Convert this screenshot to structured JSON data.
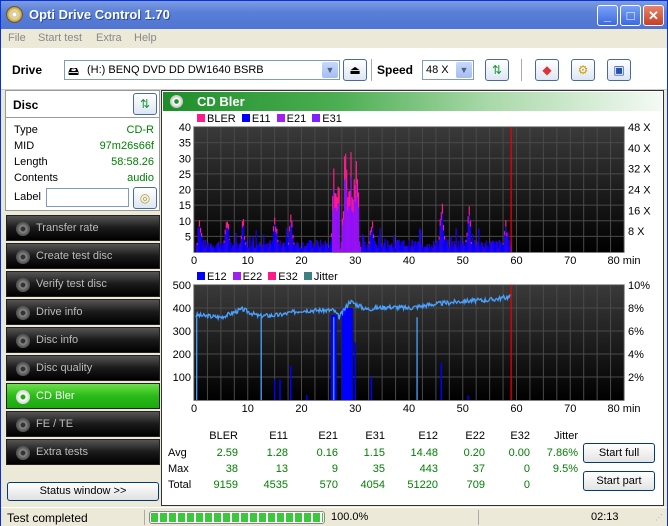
{
  "window": {
    "title": "Opti Drive Control 1.70"
  },
  "menu": [
    "File",
    "Start test",
    "Extra",
    "Help"
  ],
  "toolbar": {
    "drive_label": "Drive",
    "drive_value": "(H:)  BENQ DVD DD DW1640 BSRB",
    "speed_label": "Speed",
    "speed_value": "48 X"
  },
  "disc": {
    "title": "Disc",
    "type_k": "Type",
    "type_v": "CD-R",
    "mid_k": "MID",
    "mid_v": "97m26s66f",
    "length_k": "Length",
    "length_v": "58:58.26",
    "contents_k": "Contents",
    "contents_v": "audio",
    "label_k": "Label",
    "label_value": ""
  },
  "nav": [
    {
      "label": "Transfer rate"
    },
    {
      "label": "Create test disc"
    },
    {
      "label": "Verify test disc"
    },
    {
      "label": "Drive info"
    },
    {
      "label": "Disc info"
    },
    {
      "label": "Disc quality"
    },
    {
      "label": "CD Bler",
      "active": true
    },
    {
      "label": "FE / TE"
    },
    {
      "label": "Extra tests"
    }
  ],
  "status_window_btn": "Status window >>",
  "panel": {
    "title": "CD Bler"
  },
  "chart_data": [
    {
      "type": "bar",
      "title": "BLER / E11 / E21 / E31",
      "legend": [
        {
          "name": "BLER",
          "color": "#ff1a8c"
        },
        {
          "name": "E11",
          "color": "#0000ff"
        },
        {
          "name": "E21",
          "color": "#a020f0"
        },
        {
          "name": "E31",
          "color": "#8020ff"
        }
      ],
      "xlabel": "min",
      "xlim": [
        0,
        80
      ],
      "xticks": [
        0,
        10,
        20,
        30,
        40,
        50,
        60,
        70,
        80
      ],
      "ylim": [
        0,
        40
      ],
      "yticks": [
        5,
        10,
        15,
        20,
        25,
        30,
        35,
        40
      ],
      "y2ticks": [
        "8 X",
        "16 X",
        "24 X",
        "32 X",
        "40 X",
        "48 X"
      ],
      "end_marker_min": 59,
      "peaks": [
        [
          1,
          13
        ],
        [
          6,
          16
        ],
        [
          9,
          13
        ],
        [
          15,
          15
        ],
        [
          18,
          15
        ],
        [
          26,
          27
        ],
        [
          28,
          38
        ],
        [
          29,
          33
        ],
        [
          30,
          24
        ],
        [
          33,
          13
        ],
        [
          46,
          20
        ],
        [
          51,
          18
        ],
        [
          58,
          12
        ]
      ]
    },
    {
      "type": "bar",
      "title": "E12 / E22 / E32 / Jitter",
      "legend": [
        {
          "name": "E12",
          "color": "#0000ff"
        },
        {
          "name": "E22",
          "color": "#a020f0"
        },
        {
          "name": "E32",
          "color": "#ff1a8c"
        },
        {
          "name": "Jitter",
          "color": "#3c8080"
        }
      ],
      "xlabel": "min",
      "xlim": [
        0,
        80
      ],
      "xticks": [
        0,
        10,
        20,
        30,
        40,
        50,
        60,
        70,
        80
      ],
      "ylim": [
        0,
        500
      ],
      "yticks": [
        100,
        200,
        300,
        400,
        500
      ],
      "y2ticks": [
        "2%",
        "4%",
        "6%",
        "8%",
        "10%"
      ],
      "end_marker_min": 59,
      "e12_peaks": [
        [
          15,
          90
        ],
        [
          16,
          90
        ],
        [
          18,
          150
        ],
        [
          21,
          20
        ],
        [
          26,
          370
        ],
        [
          28,
          400
        ],
        [
          29,
          400
        ],
        [
          30,
          250
        ],
        [
          33,
          100
        ],
        [
          46,
          160
        ],
        [
          51,
          20
        ]
      ],
      "jitter_pct": [
        [
          0,
          7.4
        ],
        [
          5,
          7.2
        ],
        [
          9,
          7.9
        ],
        [
          12,
          7.3
        ],
        [
          16,
          7.4
        ],
        [
          20,
          7.8
        ],
        [
          26,
          7.8
        ],
        [
          27,
          7.2
        ],
        [
          29,
          8.6
        ],
        [
          32,
          7.9
        ],
        [
          36,
          8.1
        ],
        [
          40,
          8.0
        ],
        [
          44,
          8.3
        ],
        [
          50,
          8.6
        ],
        [
          55,
          8.7
        ],
        [
          59,
          9.0
        ]
      ]
    }
  ],
  "stats": {
    "headers": [
      "BLER",
      "E11",
      "E21",
      "E31",
      "E12",
      "E22",
      "E32",
      "Jitter"
    ],
    "rows": [
      {
        "label": "Avg",
        "values": [
          "2.59",
          "1.28",
          "0.16",
          "1.15",
          "14.48",
          "0.20",
          "0.00",
          "7.86%"
        ]
      },
      {
        "label": "Max",
        "values": [
          "38",
          "13",
          "9",
          "35",
          "443",
          "37",
          "0",
          "9.5%"
        ]
      },
      {
        "label": "Total",
        "values": [
          "9159",
          "4535",
          "570",
          "4054",
          "51220",
          "709",
          "0",
          ""
        ]
      }
    ]
  },
  "buttons": {
    "start_full": "Start full",
    "start_part": "Start part"
  },
  "statusbar": {
    "text": "Test completed",
    "progress_pct": 100,
    "progress_label": "100.0%",
    "time": "02:13"
  }
}
